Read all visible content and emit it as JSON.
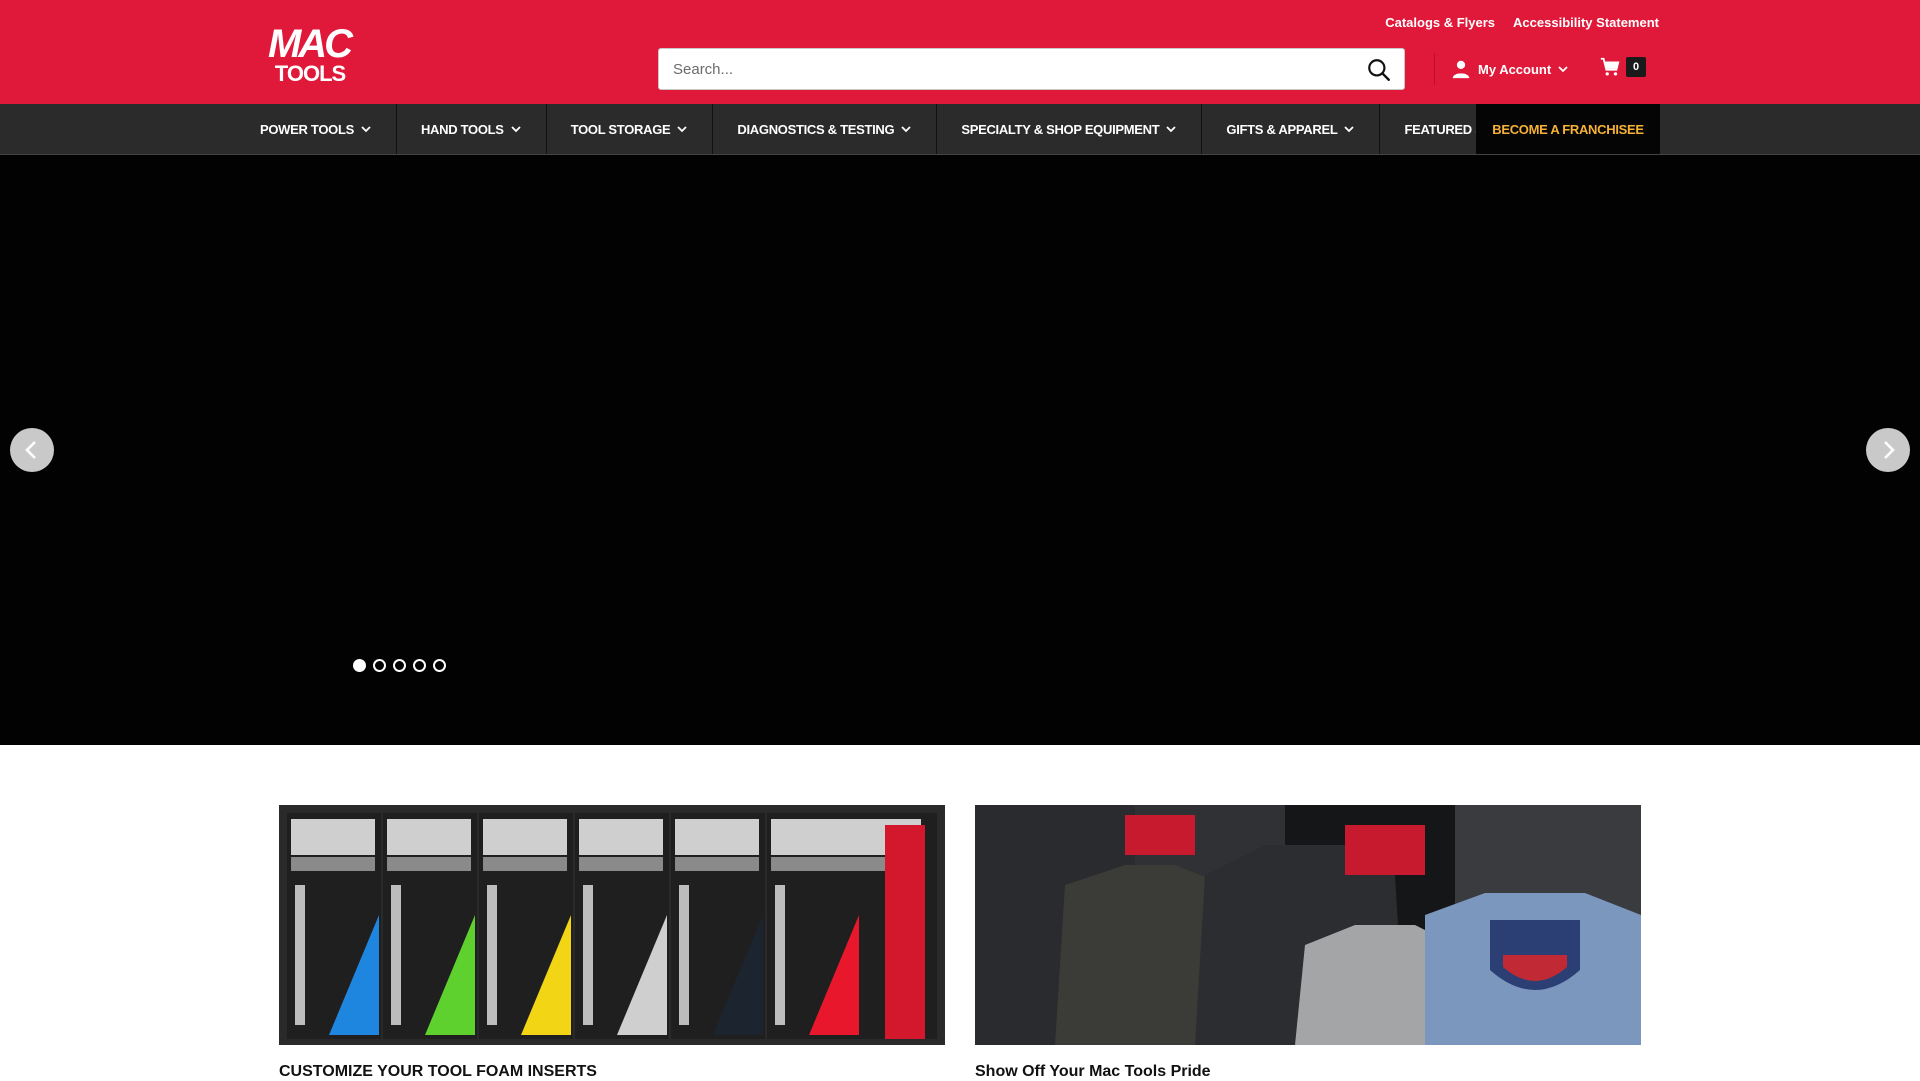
{
  "header": {
    "logo_text_top": "MAC",
    "logo_text_bottom": "TOOLS",
    "util_links": [
      "Catalogs & Flyers",
      "Accessibility Statement"
    ],
    "search_placeholder": "Search...",
    "account_label": "My Account",
    "cart_count": "0"
  },
  "nav": {
    "items": [
      "POWER TOOLS",
      "HAND TOOLS",
      "TOOL STORAGE",
      "DIAGNOSTICS & TESTING",
      "SPECIALTY & SHOP EQUIPMENT",
      "GIFTS & APPAREL",
      "FEATURED SHOPS"
    ],
    "cta_label": "BECOME A FRANCHISEE"
  },
  "hero": {
    "slide_count": 5,
    "active_slide": 1
  },
  "promos": [
    {
      "caption": "CUSTOMIZE YOUR TOOL FOAM INSERTS"
    },
    {
      "caption": "Show Off Your Mac Tools Pride"
    }
  ],
  "colors": {
    "brand_red": "#e0193a",
    "nav_bg": "#2b2b2b",
    "cta_text": "#f5b237"
  }
}
